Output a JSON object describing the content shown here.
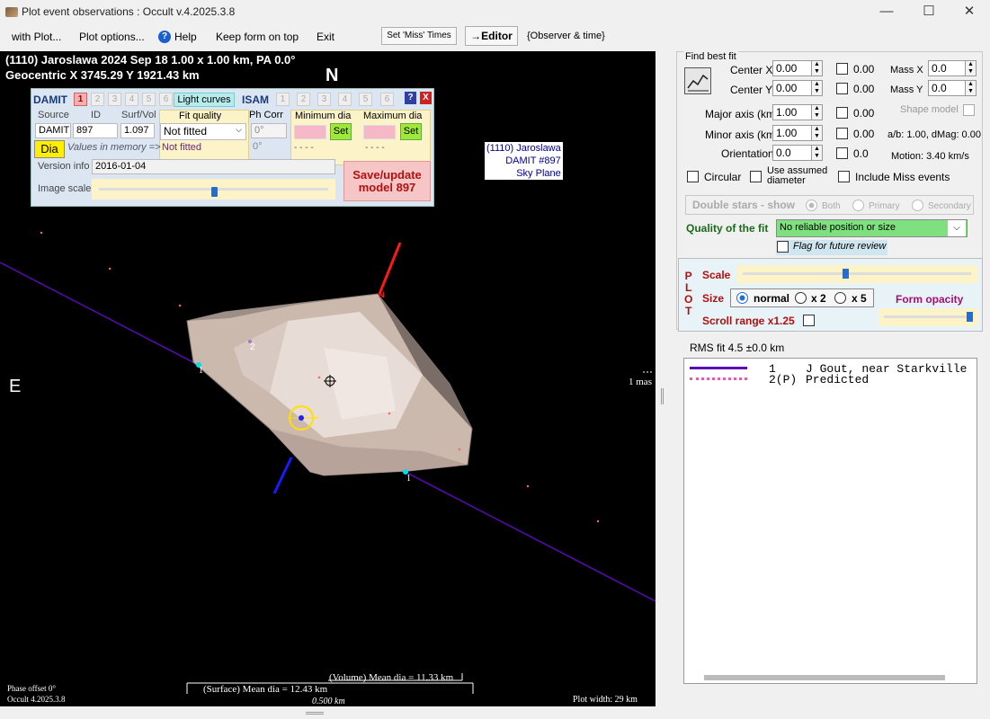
{
  "window": {
    "title": "Plot event observations : Occult v.4.2025.3.8",
    "min": "—",
    "max": "☐",
    "close": "✕"
  },
  "menu": {
    "with_plot": "with Plot...",
    "plot_options": "Plot options...",
    "help": "Help",
    "keep_on_top": "Keep form on top",
    "exit": "Exit",
    "set_miss": "Set 'Miss' Times",
    "editor": "→Editor",
    "observer_time": "{Observer & time}"
  },
  "plot": {
    "header1": "(1110) Jaroslawa  2024 Sep 18   1.00 x 1.00 km, PA 0.0°",
    "header2": "Geocentric  X  3745.29  Y  1921.43 km",
    "north": "N",
    "east": "E",
    "label_box": [
      "(1110) Jaroslawa",
      "DAMIT #897",
      "Sky Plane"
    ],
    "chord_label_1a": "1",
    "chord_label_1b": "1",
    "predicted_label": "2",
    "north_pole_label": "N",
    "right_label": "1 mas",
    "phase": "Phase offset 0°",
    "version": "Occult 4.2025.3.8",
    "volume_dia": "(Volume) Mean dia = 11.33 km",
    "surface_dia": "(Surface) Mean dia = 12.43 km",
    "scale_bar": "0.500 km",
    "plot_width": "Plot width: 29 km"
  },
  "damit": {
    "damit_label": "DAMIT",
    "nums": [
      "1",
      "2",
      "3",
      "4",
      "5",
      "6"
    ],
    "light_curves": "Light curves",
    "isam": "ISAM",
    "isam_nums": [
      "1",
      "2",
      "3",
      "4",
      "5",
      "6"
    ],
    "help": "?",
    "close": "X",
    "source_h": "Source",
    "id_h": "ID",
    "surf_h": "Surf/Vol",
    "fit_h": "Fit quality",
    "ph_h": "Ph Corr",
    "min_h": "Minimum dia",
    "max_h": "Maximum dia",
    "source": "DAMIT",
    "id": "897",
    "surf": "1.097",
    "fit": "Not fitted",
    "ph": "0°",
    "set": "Set",
    "dia": "Dia",
    "values_mem": "Values in memory =>",
    "fit_mem": "Not fitted",
    "ph_mem": "0°",
    "min_mem": "- - - -",
    "max_mem": "- - - -",
    "version_lbl": "Version info",
    "version": "2016-01-04",
    "image_scale": "Image scale",
    "save": "Save/update model 897"
  },
  "fit": {
    "title": "Find best fit",
    "center_x": "Center X",
    "center_x_val": "0.00",
    "center_x_chk": "0.00",
    "center_y": "Center Y",
    "center_y_val": "0.00",
    "center_y_chk": "0.00",
    "mass_x": "Mass X",
    "mass_x_val": "0.0",
    "mass_y": "Mass Y",
    "mass_y_val": "0.0",
    "major": "Major axis (km)",
    "major_val": "1.00",
    "major_chk": "0.00",
    "minor": "Minor axis (km)",
    "minor_val": "1.00",
    "minor_chk": "0.00",
    "orient": "Orientation",
    "orient_val": "0.0",
    "orient_chk": "0.0",
    "shape_model": "Shape model",
    "ab": "a/b: 1.00, dMag: 0.00",
    "motion": "Motion: 3.40 km/s",
    "circular": "Circular",
    "use_assumed": "Use assumed diameter",
    "include_miss": "Include Miss events",
    "double_stars": "Double stars - show",
    "both": "Both",
    "primary": "Primary",
    "secondary": "Secondary",
    "quality_lbl": "Quality of the fit",
    "quality_val": "No reliable position or size",
    "flag": "Flag for future review"
  },
  "plotctl": {
    "vert": [
      "P",
      "L",
      "O",
      "T"
    ],
    "scale": "Scale",
    "size": "Size",
    "normal": "normal",
    "x2": "x 2",
    "x5": "x 5",
    "form_opacity": "Form opacity",
    "scroll": "Scroll range x1.25"
  },
  "rms": "RMS fit 4.5 ±0.0 km",
  "legend": [
    {
      "num": "1",
      "name": "J Gout, near Starkville"
    },
    {
      "num": "2(P)",
      "name": "Predicted"
    }
  ],
  "colors": {
    "chord": "#5a0ab4",
    "shape": "#c8b7ad",
    "red": "#ff1a1a",
    "blue": "#1a1aff",
    "quality": "#7fe07f"
  }
}
